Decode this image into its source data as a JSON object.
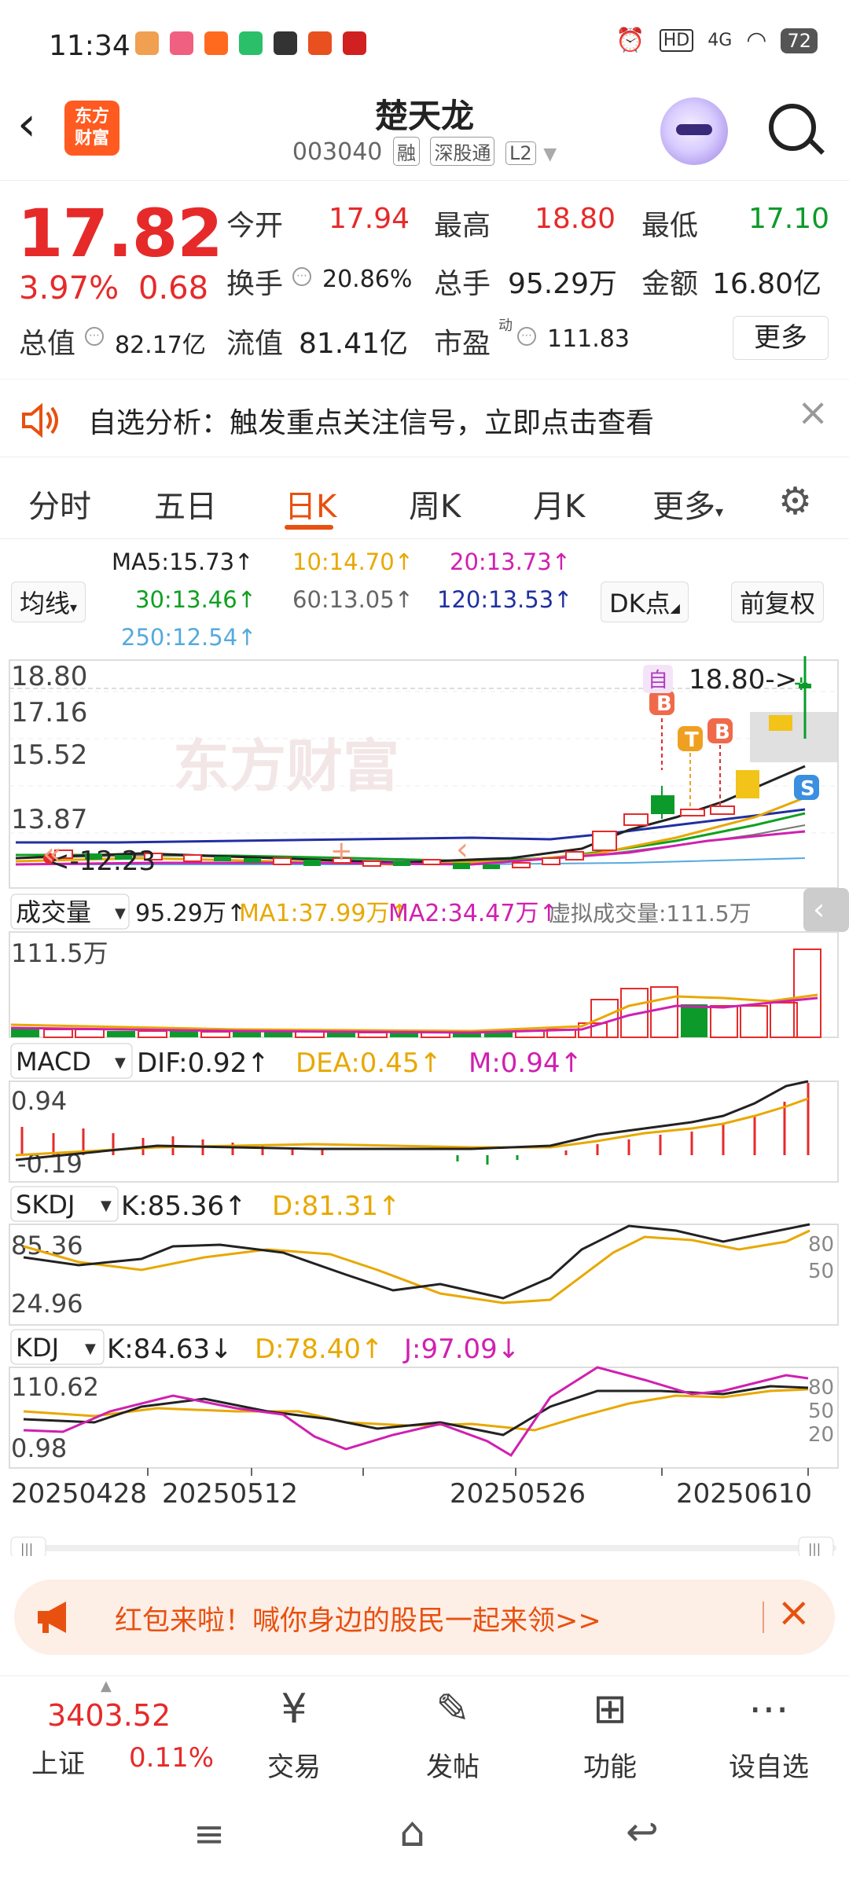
{
  "status_bar": {
    "time": "11:34",
    "battery": "72",
    "network": "4G"
  },
  "header": {
    "back_icon": "chevron-left-icon",
    "logo_text": [
      "东方",
      "财富"
    ],
    "stock_name": "楚天龙",
    "stock_code": "003040",
    "tags": [
      "融",
      "深股通",
      "L2"
    ]
  },
  "quote": {
    "price": "17.82",
    "change_pct": "3.97%",
    "change_amt": "0.68",
    "open_label": "今开",
    "open": "17.94",
    "high_label": "最高",
    "high": "18.80",
    "low_label": "最低",
    "low": "17.10",
    "turnover_label": "换手",
    "turnover": "20.86%",
    "volume_label": "总手",
    "volume": "95.29万",
    "amount_label": "金额",
    "amount": "16.80亿",
    "mktcap_label": "总值",
    "mktcap": "82.17亿",
    "float_label": "流值",
    "float": "81.41亿",
    "pe_label": "市盈",
    "pe_sup": "动",
    "pe": "111.83",
    "more_label": "更多"
  },
  "notice": {
    "text": "自选分析：触发重点关注信号，立即点击查看"
  },
  "tabs": [
    "分时",
    "五日",
    "日K",
    "周K",
    "月K",
    "更多"
  ],
  "active_tab": "日K",
  "ma": {
    "selector": "均线",
    "ma5": "MA5:15.73↑",
    "ma10": "10:14.70↑",
    "ma20": "20:13.73↑",
    "ma30": "30:13.46↑",
    "ma60": "60:13.05↑",
    "ma120": "120:13.53↑",
    "ma250": "250:12.54↑",
    "dk_button": "DK点",
    "adjust_button": "前复权",
    "colors": {
      "ma5": "#222222",
      "ma10": "#e8a800",
      "ma20": "#d020b0",
      "ma30": "#10a020",
      "ma60": "#777777",
      "ma120": "#2030a0",
      "ma250": "#55aadd"
    }
  },
  "kline": {
    "y_labels": [
      "18.80",
      "17.16",
      "15.52",
      "13.87",
      "12.23"
    ],
    "low_marker": "12.23",
    "high_marker": "18.80->",
    "self_tag": "自",
    "badges": [
      "B",
      "T",
      "B",
      "S"
    ],
    "watermark": "东方财富"
  },
  "volume": {
    "selector": "成交量",
    "value": "95.29万↑",
    "ma1": "MA1:37.99万↑",
    "ma2": "MA2:34.47万↑",
    "virtual": "虚拟成交量:111.5万",
    "max_label": "111.5万"
  },
  "macd": {
    "selector": "MACD",
    "dif": "DIF:0.92↑",
    "dea": "DEA:0.45↑",
    "m": "M:0.94↑",
    "top": "0.94",
    "bottom": "-0.19"
  },
  "skdj": {
    "selector": "SKDJ",
    "k": "K:85.36↑",
    "d": "D:81.31↑",
    "top": "85.36",
    "bottom": "24.96",
    "right": [
      "80",
      "50"
    ]
  },
  "kdj": {
    "selector": "KDJ",
    "k": "K:84.63↓",
    "d": "D:78.40↑",
    "j": "J:97.09↓",
    "top": "110.62",
    "bottom": "0.98",
    "right": [
      "80",
      "50",
      "20"
    ]
  },
  "dates": [
    "20250428",
    "20250512",
    "20250526",
    "20250610"
  ],
  "banner": {
    "text": "红包来啦！喊你身边的股民一起来领>>"
  },
  "bottom_nav": {
    "index_value": "3403.52",
    "index_name": "上证",
    "index_change": "0.11%",
    "items": [
      "交易",
      "发帖",
      "功能",
      "设自选"
    ]
  }
}
